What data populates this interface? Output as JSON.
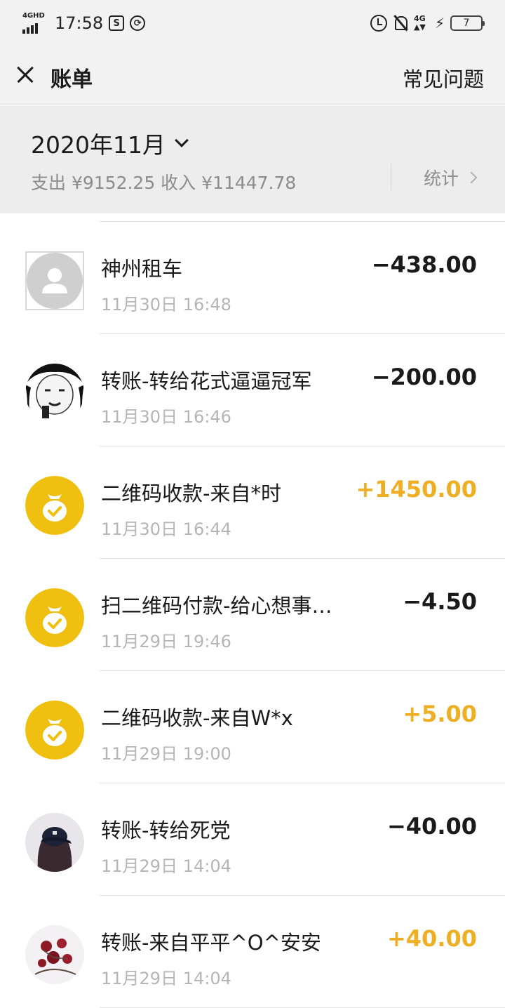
{
  "status_bar": {
    "network": "4GHD",
    "time": "17:58",
    "network_right": "4G",
    "battery": "7"
  },
  "header": {
    "title": "账单",
    "faq_label": "常见问题"
  },
  "summary": {
    "month": "2020年11月",
    "totals": "支出 ¥9152.25 收入 ¥11447.78",
    "stats_label": "统计"
  },
  "colors": {
    "income": "#eeaf24",
    "expense": "#1a1a1a",
    "coin_avatar": "#f0c010"
  },
  "transactions": [
    {
      "title": "神州租车",
      "time": "11月30日 16:48",
      "amount": "−438.00",
      "type": "expense",
      "avatar": "placeholder-avatar"
    },
    {
      "title": "转账-转给花式逼逼冠军",
      "time": "11月30日 16:46",
      "amount": "−200.00",
      "type": "expense",
      "avatar": "meme-face-avatar"
    },
    {
      "title": "二维码收款-来自*时",
      "time": "11月30日 16:44",
      "amount": "+1450.00",
      "type": "income",
      "avatar": "money-bag-icon"
    },
    {
      "title": "扫二维码付款-给心想事…",
      "time": "11月29日 19:46",
      "amount": "−4.50",
      "type": "expense",
      "avatar": "money-bag-icon"
    },
    {
      "title": "二维码收款-来自W*x",
      "time": "11月29日 19:00",
      "amount": "+5.00",
      "type": "income",
      "avatar": "money-bag-icon"
    },
    {
      "title": "转账-转给死党",
      "time": "11月29日 14:04",
      "amount": "−40.00",
      "type": "expense",
      "avatar": "person-cap-avatar"
    },
    {
      "title": "转账-来自平平^O^安安",
      "time": "11月29日 14:04",
      "amount": "+40.00",
      "type": "income",
      "avatar": "flower-avatar"
    }
  ]
}
